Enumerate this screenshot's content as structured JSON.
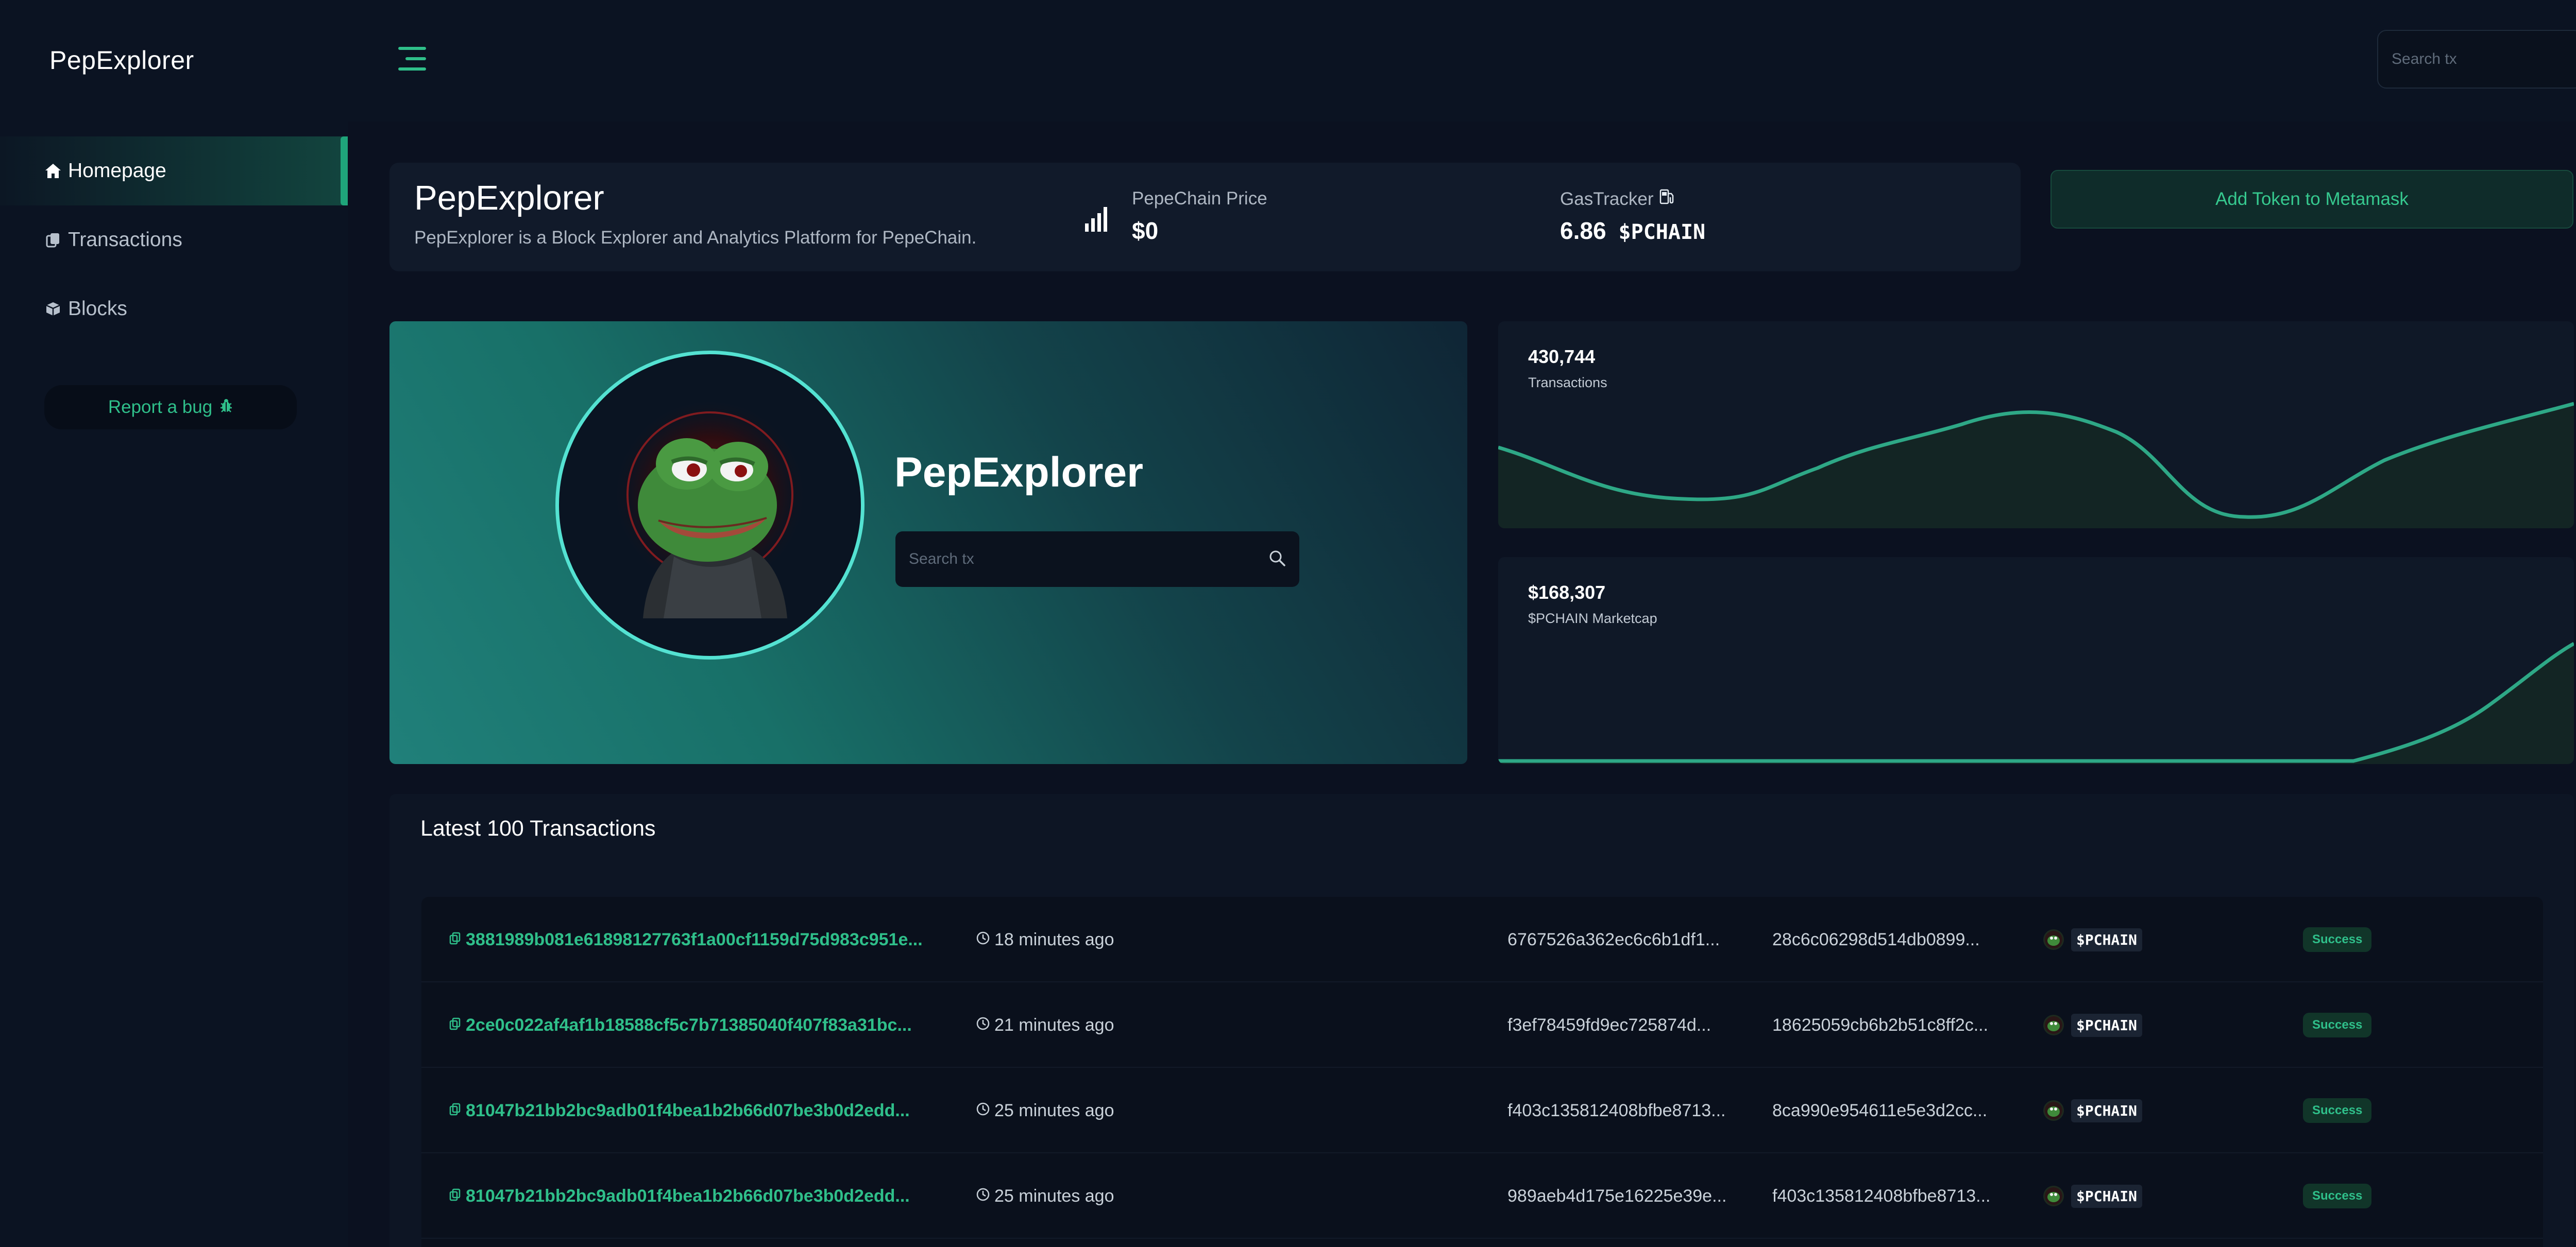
{
  "app": {
    "brand": "PepExplorer"
  },
  "sidebar": {
    "items": [
      {
        "label": "Homepage",
        "icon": "home-icon",
        "active": true
      },
      {
        "label": "Transactions",
        "icon": "copy-icon",
        "active": false
      },
      {
        "label": "Blocks",
        "icon": "cube-icon",
        "active": false
      }
    ],
    "bug_button": {
      "label": "Report a bug",
      "icon": "bug-icon"
    }
  },
  "topbar": {
    "search_placeholder": "Search tx"
  },
  "info": {
    "title": "PepExplorer",
    "description": "PepExplorer is a Block Explorer and Analytics Platform for PepeChain.",
    "price_label": "PepeChain Price",
    "price_value": "$0",
    "gas_label": "GasTracker",
    "gas_value": "6.86",
    "gas_unit": "$PCHAIN"
  },
  "metamask": {
    "label": "Add Token to Metamask"
  },
  "hero": {
    "title": "PepExplorer",
    "search_placeholder": "Search tx"
  },
  "stats": [
    {
      "value": "430,744",
      "label": "Transactions"
    },
    {
      "value": "$168,307",
      "label": "$PCHAIN Marketcap"
    }
  ],
  "transactions": {
    "title": "Latest 100 Transactions",
    "rows": [
      {
        "hash": "3881989b081e61898127763f1a00cf1159d75d983c951e...",
        "time": "18 minutes ago",
        "from": "6767526a362ec6c6b1df1...",
        "to": "28c6c06298d514db0899...",
        "token": "$PCHAIN",
        "status": "Success"
      },
      {
        "hash": "2ce0c022af4af1b18588cf5c7b71385040f407f83a31bc...",
        "time": "21 minutes ago",
        "from": "f3ef78459fd9ec725874d...",
        "to": "18625059cb6b2b51c8ff2c...",
        "token": "$PCHAIN",
        "status": "Success"
      },
      {
        "hash": "81047b21bb2bc9adb01f4bea1b2b66d07be3b0d2edd...",
        "time": "25 minutes ago",
        "from": "f403c135812408bfbe8713...",
        "to": "8ca990e954611e5e3d2cc...",
        "token": "$PCHAIN",
        "status": "Success"
      },
      {
        "hash": "81047b21bb2bc9adb01f4bea1b2b66d07be3b0d2edd...",
        "time": "25 minutes ago",
        "from": "989aeb4d175e16225e39e...",
        "to": "f403c135812408bfbe8713...",
        "token": "$PCHAIN",
        "status": "Success"
      }
    ]
  },
  "colors": {
    "background": "#0b1120",
    "accent": "#2fbf8a",
    "chart_line": "#2ea886"
  }
}
